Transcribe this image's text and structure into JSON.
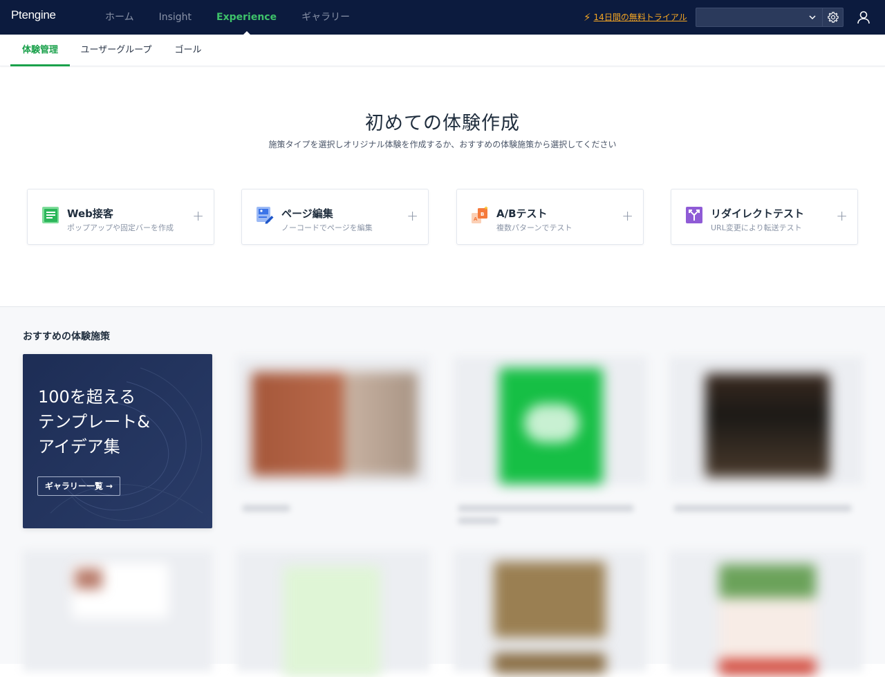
{
  "app": {
    "logo": "Ptengine"
  },
  "nav": {
    "items": [
      {
        "label": "ホーム"
      },
      {
        "label": "Insight"
      },
      {
        "label": "Experience"
      },
      {
        "label": "ギャラリー"
      }
    ],
    "active": "Experience"
  },
  "trial": {
    "label": "14日間の無料トライアル",
    "color": "#f5a623"
  },
  "project_select": {
    "value": ""
  },
  "subnav": {
    "tabs": [
      {
        "label": "体験管理"
      },
      {
        "label": "ユーザーグループ"
      },
      {
        "label": "ゴール"
      }
    ],
    "active": "体験管理",
    "accent": "#1aa14b"
  },
  "hero": {
    "title": "初めての体験作成",
    "subtitle": "施策タイプを選択しオリジナル体験を作成するか、おすすめの体験施策から選択してください"
  },
  "cards": [
    {
      "title": "Web接客",
      "subtitle": "ポップアップや固定バーを作成",
      "icon": "web-reception-icon"
    },
    {
      "title": "ページ編集",
      "subtitle": "ノーコードでページを編集",
      "icon": "page-edit-icon"
    },
    {
      "title": "A/Bテスト",
      "subtitle": "複数パターンでテスト",
      "icon": "ab-test-icon"
    },
    {
      "title": "リダイレクトテスト",
      "subtitle": "URL変更により転送テスト",
      "icon": "redirect-test-icon"
    }
  ],
  "recommendations": {
    "title": "おすすめの体験施策",
    "promo": {
      "text": "100を超える\nテンプレート&\nアイデア集",
      "button": "ギャラリー一覧 →"
    }
  }
}
